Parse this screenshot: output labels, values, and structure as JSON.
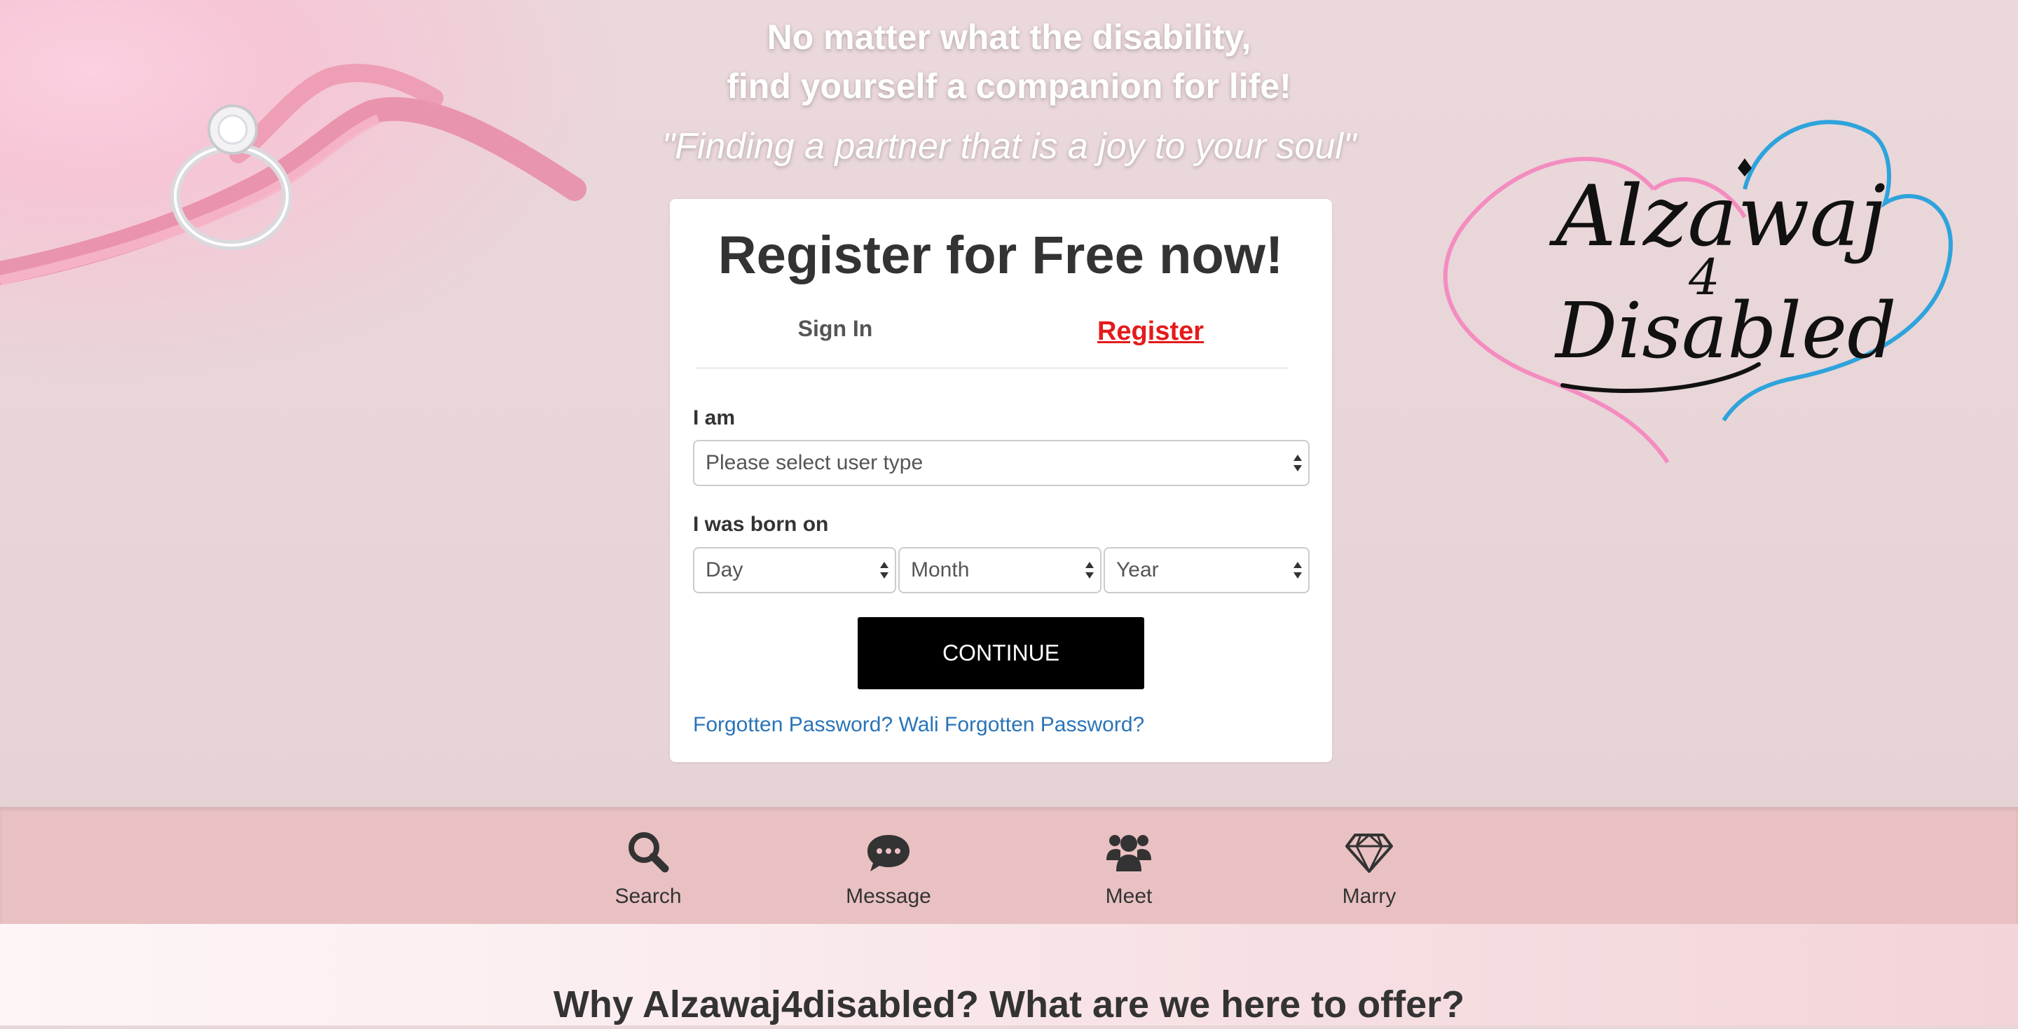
{
  "hero": {
    "tagline_line1": "No matter what the disability,",
    "tagline_line2": "find yourself a companion for life!",
    "quote": "\"Finding a partner that is a joy to your soul\""
  },
  "logo": {
    "text_main": "Alzawaj",
    "text_num": "4",
    "text_sub": "Disabled",
    "colors": {
      "heart_left": "#f48cc0",
      "heart_right": "#2ea3dc",
      "ink": "#111111"
    }
  },
  "card": {
    "title": "Register for Free now!",
    "tabs": {
      "signin": "Sign In",
      "register": "Register"
    },
    "user_type_label": "I am",
    "user_type_placeholder": "Please select user type",
    "dob_label": "I was born on",
    "day": "Day",
    "month": "Month",
    "year": "Year",
    "continue": "CONTINUE",
    "forgot_password": "Forgotten Password?",
    "wali_forgot_password": "Wali Forgotten Password?"
  },
  "features": [
    {
      "label": "Search",
      "icon": "search-icon"
    },
    {
      "label": "Message",
      "icon": "chat-bubble-icon"
    },
    {
      "label": "Meet",
      "icon": "users-icon"
    },
    {
      "label": "Marry",
      "icon": "diamond-icon"
    }
  ],
  "why": {
    "title": "Why Alzawaj4disabled? What are we here to offer?"
  },
  "colors": {
    "accent_register": "#e41b1b",
    "link": "#2a74b8",
    "feature_bar": "#e9c1c3",
    "button": "#000000"
  }
}
